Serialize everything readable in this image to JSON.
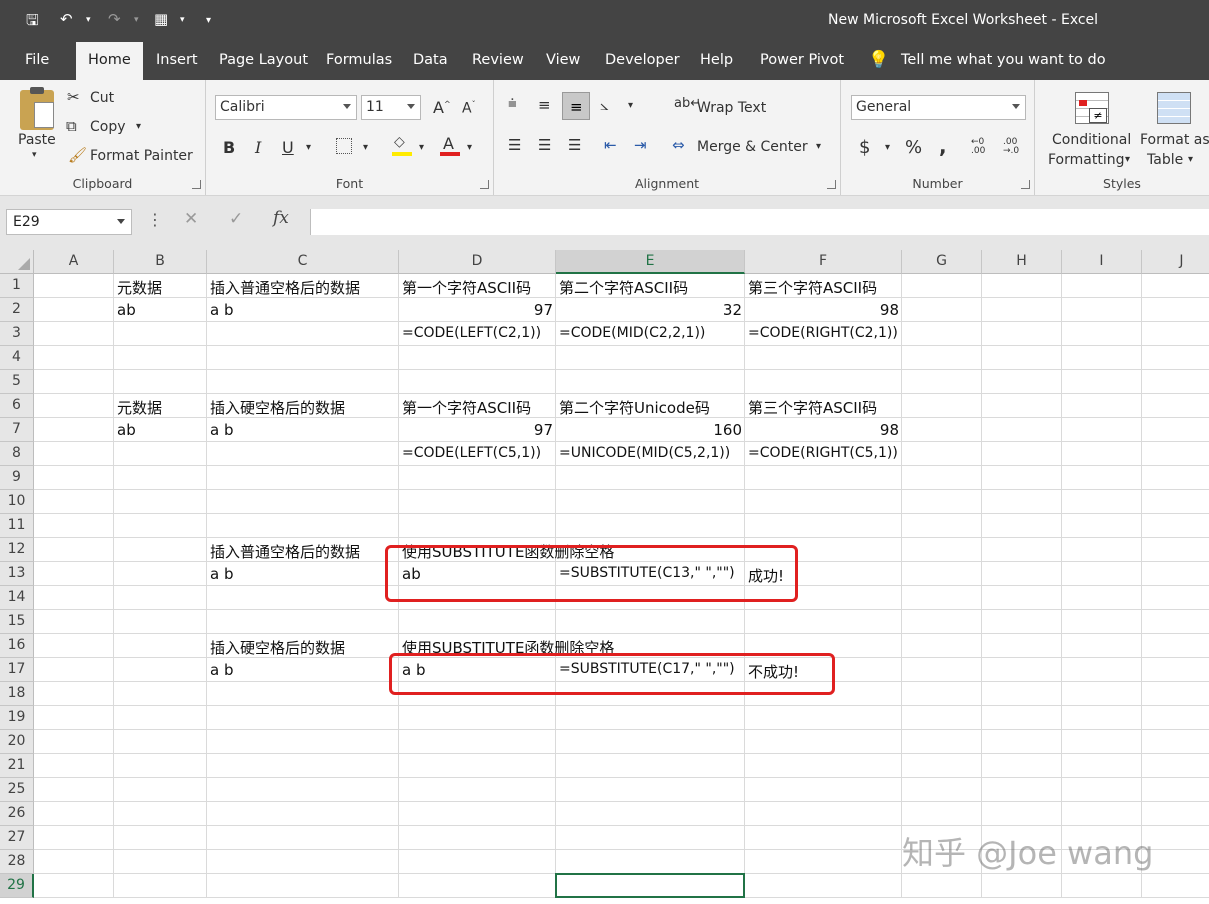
{
  "window": {
    "title": "New Microsoft Excel Worksheet  -  Excel"
  },
  "menu": [
    "File",
    "Home",
    "Insert",
    "Page Layout",
    "Formulas",
    "Data",
    "Review",
    "View",
    "Developer",
    "Help",
    "Power Pivot"
  ],
  "tell_me": "Tell me what you want to do",
  "ribbon": {
    "clipboard": {
      "label": "Clipboard",
      "paste": "Paste",
      "cut": "Cut",
      "copy": "Copy",
      "format_painter": "Format Painter"
    },
    "font": {
      "label": "Font",
      "family": "Calibri",
      "size": "11",
      "bold": "B",
      "italic": "I",
      "underline": "U"
    },
    "alignment": {
      "label": "Alignment",
      "wrap": "Wrap Text",
      "merge": "Merge & Center"
    },
    "number": {
      "label": "Number",
      "format": "General",
      "currency": "$",
      "percent": "%",
      "comma": ","
    },
    "styles": {
      "label": "Styles",
      "conditional_1": "Conditional",
      "conditional_2": "Formatting",
      "format_as_1": "Format as",
      "format_as_2": "Table"
    }
  },
  "formula_bar": {
    "name_box": "E29",
    "fx": "fx",
    "value": ""
  },
  "columns": [
    "A",
    "B",
    "C",
    "D",
    "E",
    "F",
    "G",
    "H",
    "I",
    "J"
  ],
  "rows": [
    "1",
    "2",
    "3",
    "4",
    "5",
    "6",
    "7",
    "8",
    "9",
    "10",
    "11",
    "12",
    "13",
    "14",
    "15",
    "16",
    "17",
    "18",
    "19",
    "20",
    "21",
    "25",
    "26",
    "27",
    "28",
    "29"
  ],
  "cells": {
    "B1": "元数据",
    "C1": "插入普通空格后的数据",
    "D1": "第一个字符ASCII码",
    "E1": "第二个字符ASCII码",
    "F1": "第三个字符ASCII码",
    "B2": "ab",
    "C2": "a b",
    "D2": "97",
    "E2": "32",
    "F2": "98",
    "D3": "=CODE(LEFT(C2,1))",
    "E3": "=CODE(MID(C2,2,1))",
    "F3": "=CODE(RIGHT(C2,1))",
    "B6": "元数据",
    "C6": "插入硬空格后的数据",
    "D6": "第一个字符ASCII码",
    "E6": "第二个字符Unicode码",
    "F6": "第三个字符ASCII码",
    "B7": "ab",
    "C7": "a b",
    "D7": "97",
    "E7": "160",
    "F7": "98",
    "D8": "=CODE(LEFT(C5,1))",
    "E8": "=UNICODE(MID(C5,2,1))",
    "F8": "=CODE(RIGHT(C5,1))",
    "C12": "插入普通空格后的数据",
    "D12": "使用SUBSTITUTE函数删除空格",
    "C13": "a b",
    "D13": "ab",
    "E13": "=SUBSTITUTE(C13,\" \",\"\")",
    "F13": "成功!",
    "C16": "插入硬空格后的数据",
    "D16": "使用SUBSTITUTE函数删除空格",
    "C17": "a b",
    "D17": "a b",
    "E17": "=SUBSTITUTE(C17,\" \",\"\")",
    "F17": "不成功!"
  },
  "watermark": "知乎 @Joe wang"
}
